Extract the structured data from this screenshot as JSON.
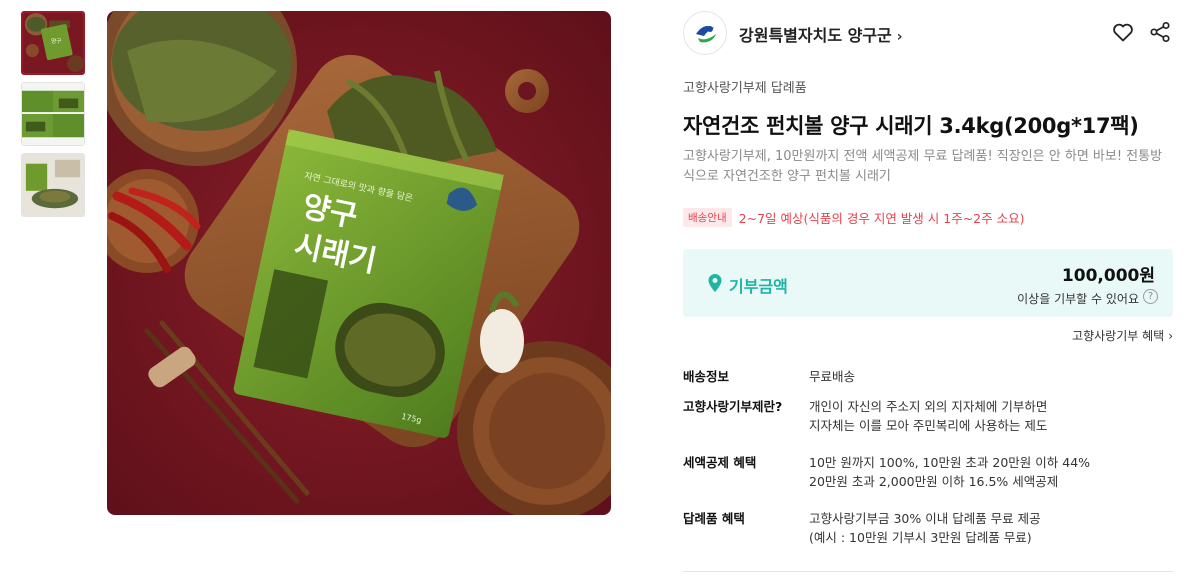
{
  "thumbnails": [
    {
      "name": "thumb-1",
      "active": true
    },
    {
      "name": "thumb-2",
      "active": false
    },
    {
      "name": "thumb-3",
      "active": false
    }
  ],
  "product_image": {
    "package_text_main": "양구\n시래기",
    "package_text_top": "자연 그대로의 맛과 향을 담은",
    "package_weight": "175g"
  },
  "brand": {
    "name": "강원특별자치도 양구군",
    "chevron": "›"
  },
  "category": "고향사랑기부제 답례품",
  "title": "자연건조 펀치볼 양구 시래기 3.4kg(200g*17팩)",
  "description": "고향사랑기부제, 10만원까지 전액 세액공제 무료 답례품! 직장인은 안 하면 바보! 전통방식으로 자연건조한 양구 펀치볼 시래기",
  "shipping": {
    "badge": "배송안내",
    "text": "2~7일 예상(식품의 경우 지연 발생 시 1주~2주 소요)"
  },
  "donation": {
    "label": "기부금액",
    "amount": "100,000원",
    "sub": "이상을 기부할 수 있어요",
    "help": "?"
  },
  "benefit_link": "고향사랑기부 혜택",
  "specs": [
    {
      "label": "배송정보",
      "lines": [
        "무료배송"
      ]
    },
    {
      "label": "고향사랑기부제란?",
      "lines": [
        "개인이 자신의 주소지 외의 지자체에 기부하면",
        "지자체는 이를 모아 주민복리에 사용하는 제도"
      ]
    },
    {
      "label": "세액공제 혜택",
      "lines": [
        "10만 원까지 100%, 10만원 초과 20만원 이하 44%",
        "20만원 초과 2,000만원 이하 16.5% 세액공제"
      ]
    },
    {
      "label": "답례품 혜택",
      "lines": [
        "고향사랑기부금 30% 이내 답례품 무료 제공",
        "(예시 : 10만원 기부시 3만원 답례품 무료)"
      ]
    }
  ],
  "colors": {
    "accent": "#1fb5a5",
    "donation_bg": "#e9f9f7",
    "shipping_red": "#e8424e",
    "image_bg": "#7a1822"
  }
}
